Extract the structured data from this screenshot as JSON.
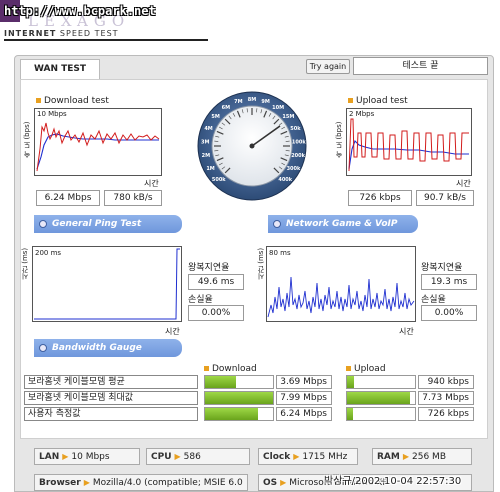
{
  "header": {
    "url": "http://www.bcpark.net",
    "brand_ghost": "LEXAGO",
    "subtitle_bold": "INTERNET",
    "subtitle_rest": " SPEED TEST"
  },
  "tabs": {
    "wan": "WAN TEST"
  },
  "controls": {
    "try_again": "Try again",
    "status": "테스트 끝"
  },
  "download": {
    "title": "Download test",
    "axis_v": "속 도 (bps)",
    "scale": "10 Mbps",
    "axis_t": "시간",
    "speed": "6.24 Mbps",
    "bytes": "780 kB/s"
  },
  "upload": {
    "title": "Upload test",
    "axis_v": "속 도 (bps)",
    "scale": "2 Mbps",
    "axis_t": "시간",
    "speed": "726 kbps",
    "bytes": "90.7 kB/s"
  },
  "gauge": {
    "labels": [
      "500k",
      "1M",
      "2M",
      "3M",
      "4M",
      "5M",
      "6M",
      "7M",
      "8M",
      "9M",
      "10M",
      "15M",
      "50k",
      "100k",
      "200k",
      "300k",
      "400k"
    ],
    "needle_value": "6.24 Mbps",
    "ring_color": "#3a5f96",
    "accent": "#e8a020"
  },
  "ping": {
    "title": "General Ping Test",
    "axis_v": "시간 (ms)",
    "scale": "200 ms",
    "axis_t": "시간",
    "rtt_label": "왕복지연율",
    "rtt_value": "49.6 ms",
    "loss_label": "손실율",
    "loss_value": "0.00%"
  },
  "game": {
    "title": "Network Game & VoIP Test",
    "axis_v": "시간 (ms)",
    "scale": "80 ms",
    "axis_t": "시간",
    "rtt_label": "왕복지연율",
    "rtt_value": "19.3 ms",
    "loss_label": "손실율",
    "loss_value": "0.00%"
  },
  "bandwidth": {
    "title": "Bandwidth Gauge",
    "col_download": "Download",
    "col_upload": "Upload",
    "rows": [
      {
        "label": "보라홈넷 케이블모뎀 평균",
        "down": "3.69 Mbps",
        "down_fill": 0.46,
        "up": "940 kbps",
        "up_fill": 0.11
      },
      {
        "label": "보라홈넷 케이블모뎀 최대값",
        "down": "7.99 Mbps",
        "down_fill": 1.0,
        "up": "7.73 Mbps",
        "up_fill": 0.93
      },
      {
        "label": "사용자 측정값",
        "down": "6.24 Mbps",
        "down_fill": 0.78,
        "up": "726 kbps",
        "up_fill": 0.09
      }
    ]
  },
  "info": {
    "lan_k": "LAN",
    "lan_v": "10 Mbps",
    "cpu_k": "CPU",
    "cpu_v": "586",
    "clock_k": "Clock",
    "clock_v": "1715 MHz",
    "ram_k": "RAM",
    "ram_v": "256 MB",
    "browser_k": "Browser",
    "browser_v": "Mozilla/4.0 (compatible; MSIE 6.0",
    "os_k": "OS",
    "os_v": "Microsoft Windows XP"
  },
  "watermark": "박상규/2002-10-04 22:57:30"
}
